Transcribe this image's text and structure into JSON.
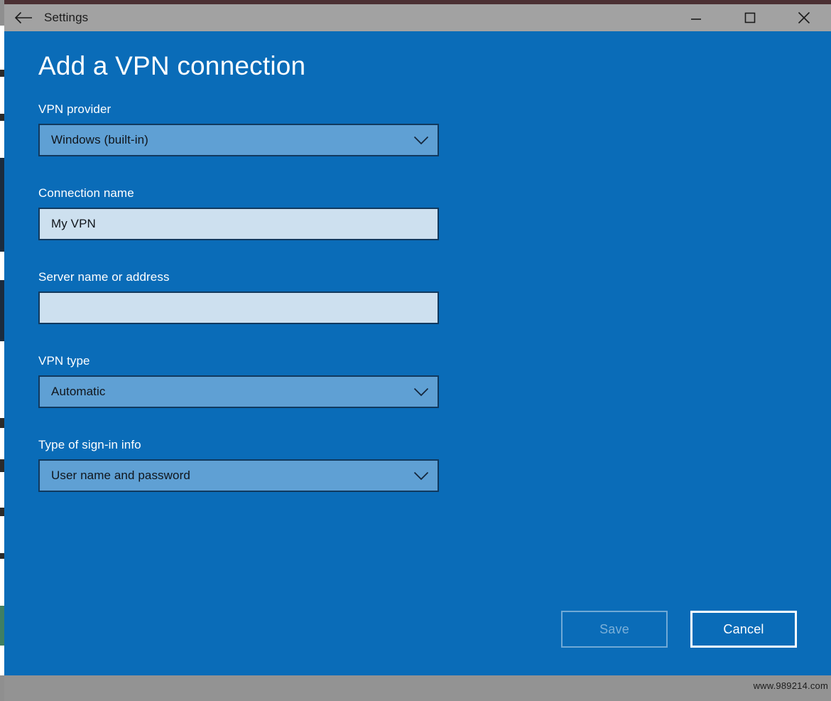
{
  "window": {
    "title": "Settings",
    "back_icon": "back-arrow-icon",
    "minimize_label": "–",
    "maximize_label": "□",
    "close_label": "✕"
  },
  "page": {
    "heading": "Add a VPN connection"
  },
  "form": {
    "fields": [
      {
        "label": "VPN provider",
        "control": "dropdown",
        "value": "Windows (built-in)"
      },
      {
        "label": "Connection name",
        "control": "textbox",
        "value": "My VPN",
        "placeholder": ""
      },
      {
        "label": "Server name or address",
        "control": "textbox",
        "value": "",
        "placeholder": ""
      },
      {
        "label": "VPN type",
        "control": "dropdown",
        "value": "Automatic"
      },
      {
        "label": "Type of sign-in info",
        "control": "dropdown",
        "value": "User name and password"
      }
    ]
  },
  "actions": {
    "save_label": "Save",
    "save_enabled": false,
    "cancel_label": "Cancel"
  },
  "footer": {
    "watermark": "www.989214.com"
  },
  "colors": {
    "panel_blue": "#0a6cb8",
    "dropdown_blue": "#5fa0d4",
    "textbox_blue": "#cde0ef",
    "control_border": "#11395e",
    "titlebar_gray": "#a2a2a2",
    "footer_gray": "#939393"
  }
}
